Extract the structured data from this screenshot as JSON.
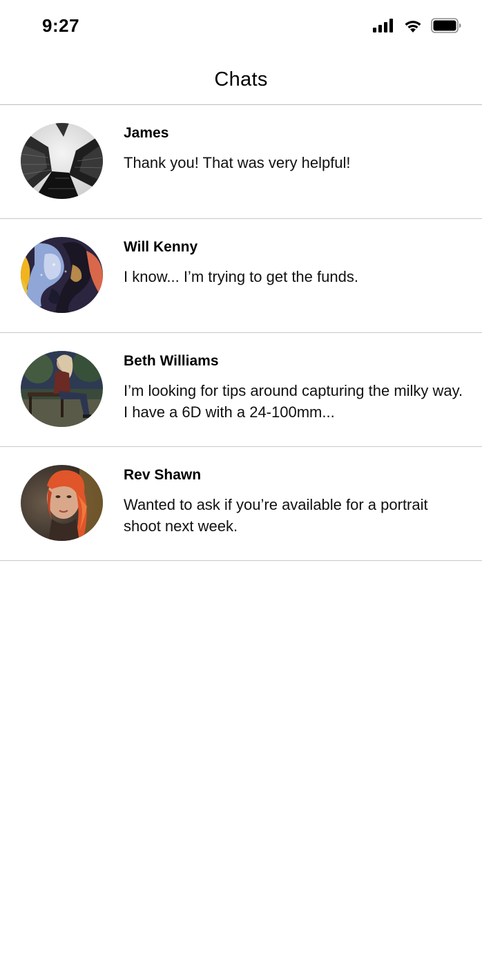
{
  "status_bar": {
    "time": "9:27",
    "icons": [
      "cellular-signal-icon",
      "wifi-icon",
      "battery-icon"
    ]
  },
  "header": {
    "title": "Chats"
  },
  "chats": [
    {
      "name": "James",
      "message": "Thank you! That was very helpful!",
      "avatar": "avatar-skyscrapers"
    },
    {
      "name": "Will Kenny",
      "message": "I know... I’m trying to get the funds.",
      "avatar": "avatar-abstract-paint"
    },
    {
      "name": "Beth Williams",
      "message": "I’m looking for tips around capturing the milky way. I have a 6D with a 24-100mm...",
      "avatar": "avatar-woman-on-bench"
    },
    {
      "name": "Rev Shawn",
      "message": "Wanted to ask if you’re available for a portrait shoot next week.",
      "avatar": "avatar-woman-red-hair"
    }
  ]
}
